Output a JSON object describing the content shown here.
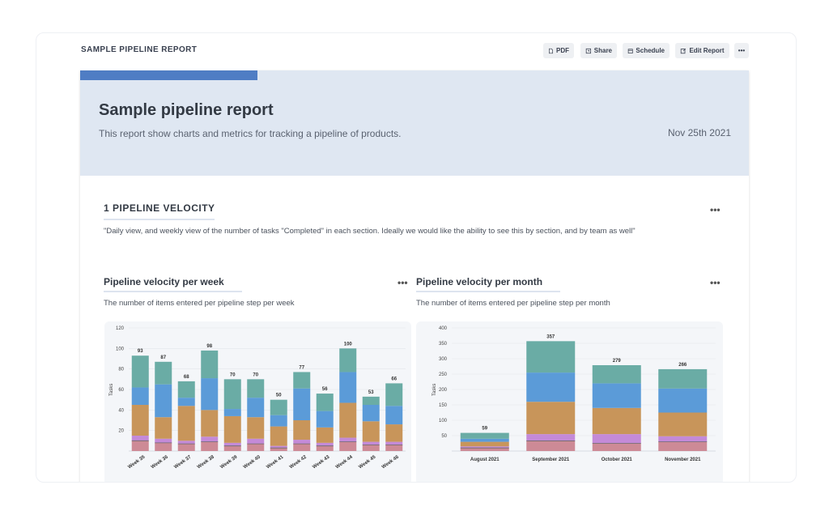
{
  "header": {
    "title": "SAMPLE PIPELINE REPORT",
    "buttons": {
      "pdf": "PDF",
      "share": "Share",
      "schedule": "Schedule",
      "edit": "Edit Report",
      "more": "•••"
    }
  },
  "report": {
    "title": "Sample pipeline report",
    "description": "This report show charts and metrics for tracking a pipeline of products.",
    "date": "Nov 25th 2021"
  },
  "section": {
    "title": "1 PIPELINE VELOCITY",
    "description": "\"Daily view, and weekly view of the number of tasks \"Completed\" in each section. Ideally we would like the ability to see this by section, and by team as well\"",
    "more": "•••"
  },
  "colors": {
    "teal": "#6aaca5",
    "blue": "#5b9bd8",
    "orange": "#c8955a",
    "purple": "#c48ad8",
    "pink": "#cd8a96",
    "dark": "#5a5a5a"
  },
  "chart_data": [
    {
      "type": "bar",
      "title": "Pipeline velocity per week",
      "subtitle": "The number of items entered per pipeline step per week",
      "ylabel": "Tasks",
      "ylim": [
        0,
        120
      ],
      "yticks": [
        20,
        40,
        60,
        80,
        100,
        120
      ],
      "stacked": true,
      "categories": [
        "Week 35",
        "Week 36",
        "Week 37",
        "Week 38",
        "Week 39",
        "Week 40",
        "Week 41",
        "Week 42",
        "Week 43",
        "Week 44",
        "Week 45",
        "Week 46"
      ],
      "totals": [
        93,
        87,
        68,
        98,
        70,
        70,
        50,
        77,
        56,
        100,
        53,
        66
      ],
      "series": [
        {
          "values": [
            10,
            8,
            7,
            9,
            5,
            7,
            3,
            7,
            5,
            9,
            6,
            6
          ],
          "color": "#cd8a96"
        },
        {
          "values": [
            5,
            4,
            3,
            5,
            3,
            5,
            2,
            4,
            3,
            4,
            3,
            3
          ],
          "color": "#c48ad8"
        },
        {
          "values": [
            30,
            21,
            34,
            26,
            26,
            21,
            19,
            19,
            15,
            34,
            20,
            17
          ],
          "color": "#c8955a"
        },
        {
          "values": [
            17,
            32,
            8,
            31,
            7,
            19,
            11,
            31,
            16,
            30,
            16,
            18
          ],
          "color": "#5b9bd8"
        },
        {
          "values": [
            31,
            22,
            16,
            27,
            29,
            18,
            15,
            16,
            17,
            23,
            8,
            22
          ],
          "color": "#6aaca5"
        }
      ],
      "more": "•••"
    },
    {
      "type": "bar",
      "title": "Pipeline velocity per month",
      "subtitle": "The number of items entered per pipeline step per month",
      "ylabel": "Tasks",
      "ylim": [
        0,
        400
      ],
      "yticks": [
        50,
        100,
        150,
        200,
        250,
        300,
        350,
        400
      ],
      "stacked": true,
      "categories": [
        "August 2021",
        "September 2021",
        "October 2021",
        "November 2021"
      ],
      "totals": [
        59,
        357,
        279,
        266
      ],
      "series": [
        {
          "values": [
            10,
            33,
            25,
            30
          ],
          "color": "#cd8a96"
        },
        {
          "values": [
            5,
            22,
            30,
            18
          ],
          "color": "#c48ad8"
        },
        {
          "values": [
            15,
            105,
            85,
            77
          ],
          "color": "#c8955a"
        },
        {
          "values": [
            10,
            95,
            80,
            78
          ],
          "color": "#5b9bd8"
        },
        {
          "values": [
            19,
            102,
            59,
            63
          ],
          "color": "#6aaca5"
        }
      ],
      "more": "•••"
    }
  ]
}
